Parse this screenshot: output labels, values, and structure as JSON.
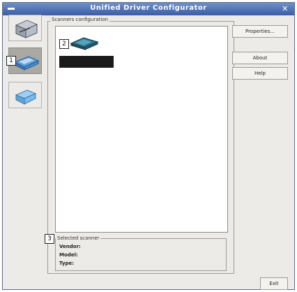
{
  "window": {
    "title": "Unified Driver Configurator"
  },
  "sidebar": {
    "items": [
      {
        "name": "printers",
        "icon": "printer-icon"
      },
      {
        "name": "scanners",
        "icon": "scanner-icon",
        "active": true
      },
      {
        "name": "ports",
        "icon": "port-icon"
      }
    ]
  },
  "callouts": {
    "one": "1",
    "two": "2",
    "three": "3"
  },
  "scanners": {
    "group_label": "Scanners configuration",
    "properties_label": "Properties...",
    "about_label": "About",
    "help_label": "Help"
  },
  "selected": {
    "group_label": "Selected scanner",
    "vendor_label": "Vendor:",
    "model_label": "Model:",
    "type_label": "Type:"
  },
  "footer": {
    "exit_label": "Exit"
  },
  "colors": {
    "titlebar": "#3a5da6",
    "active_tab": "#a9a8a3",
    "selection": "#1a1a1a"
  }
}
